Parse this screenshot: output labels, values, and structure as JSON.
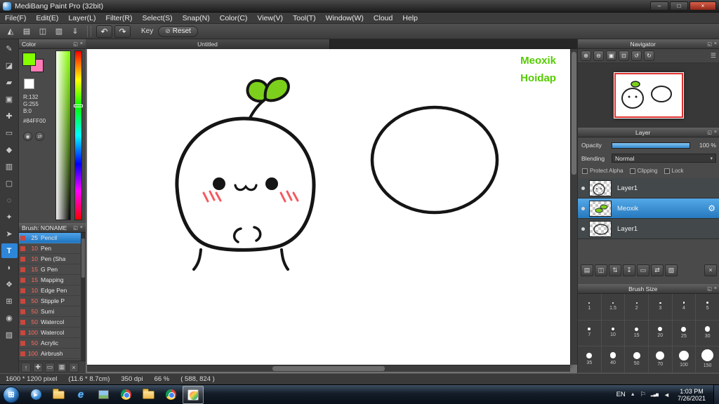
{
  "window": {
    "title": "MediBang Paint Pro (32bit)"
  },
  "menu": {
    "items": [
      "File(F)",
      "Edit(E)",
      "Layer(L)",
      "Filter(R)",
      "Select(S)",
      "Snap(N)",
      "Color(C)",
      "View(V)",
      "Tool(T)",
      "Window(W)",
      "Cloud",
      "Help"
    ]
  },
  "toolbar": {
    "key_label": "Key",
    "reset_label": "Reset"
  },
  "color_panel": {
    "title": "Color",
    "foreground_hex": "#84FF00",
    "background_hex": "#FF7BB8",
    "rgb": [
      "R:132",
      "G:255",
      "B:0"
    ],
    "hex_label": "#84FF00"
  },
  "brush_panel": {
    "title": "Brush: NONAME",
    "items": [
      {
        "size": "25",
        "name": "Pencil",
        "selected": true
      },
      {
        "size": "10",
        "name": "Pen"
      },
      {
        "size": "10",
        "name": "Pen (Sha"
      },
      {
        "size": "15",
        "name": "G Pen"
      },
      {
        "size": "15",
        "name": "Mapping"
      },
      {
        "size": "10",
        "name": "Edge Pen"
      },
      {
        "size": "50",
        "name": "Stipple P"
      },
      {
        "size": "50",
        "name": "Sumi"
      },
      {
        "size": "50",
        "name": "Watercol"
      },
      {
        "size": "100",
        "name": "Watercol"
      },
      {
        "size": "50",
        "name": "Acrylic"
      },
      {
        "size": "100",
        "name": "Airbrush"
      }
    ]
  },
  "canvas": {
    "tab": "Untitled",
    "annotations": [
      "Meoxik",
      "Hoidap"
    ],
    "annotation_color": "#55CC00"
  },
  "navigator": {
    "title": "Navigator"
  },
  "layer_panel": {
    "title": "Layer",
    "opacity_label": "Opacity",
    "opacity_value": "100 %",
    "blending_label": "Blending",
    "blending_value": "Normal",
    "protect_alpha": "Protect Alpha",
    "clipping": "Clipping",
    "lock": "Lock",
    "layers": [
      {
        "name": "Layer1"
      },
      {
        "name": "Meoxik",
        "selected": true
      },
      {
        "name": "Layer1"
      }
    ]
  },
  "brush_size_panel": {
    "title": "Brush Size",
    "sizes": [
      "1",
      "1.5",
      "2",
      "3",
      "4",
      "5",
      "7",
      "10",
      "15",
      "20",
      "25",
      "30",
      "35",
      "40",
      "50",
      "70",
      "100",
      "150"
    ]
  },
  "status": {
    "dimensions": "1600 * 1200 pixel",
    "physical": "(11.6 * 8.7cm)",
    "dpi": "350 dpi",
    "zoom": "66 %",
    "coords": "( 588, 824 )"
  },
  "taskbar": {
    "language": "EN",
    "time": "1:03 PM",
    "date": "7/26/2021",
    "icons": [
      "media-player-icon",
      "explorer-folder-icon",
      "internet-explorer-icon",
      "photo-viewer-icon",
      "chrome-icon",
      "documents-folder-icon",
      "chrome-icon-2",
      "medibang-icon"
    ]
  }
}
